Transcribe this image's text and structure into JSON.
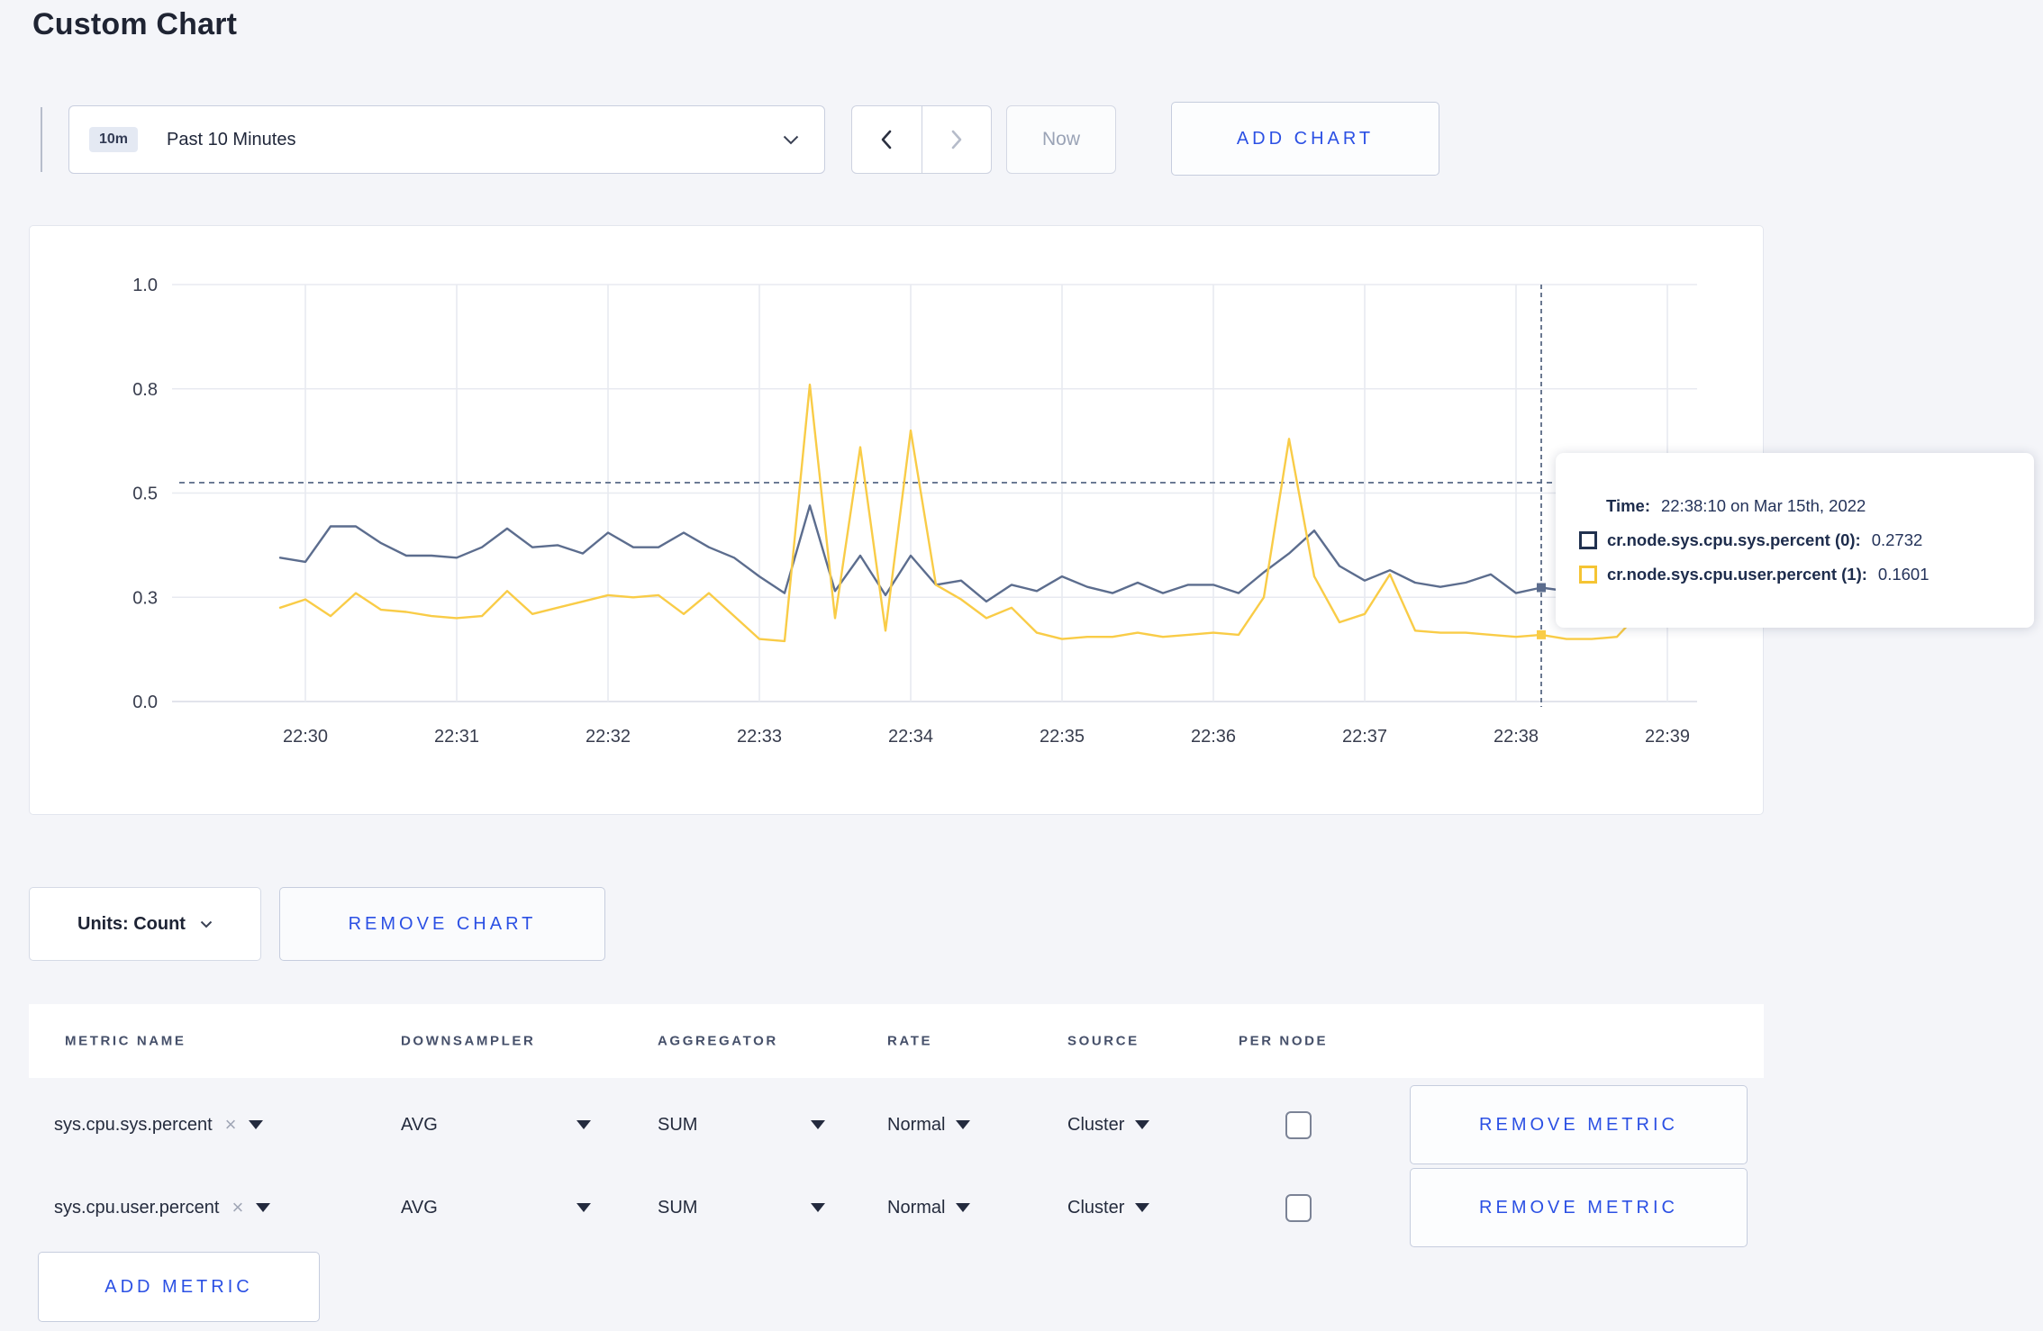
{
  "page": {
    "title": "Custom Chart"
  },
  "toolbar": {
    "range_badge": "10m",
    "range_label": "Past 10 Minutes",
    "now_label": "Now",
    "add_chart_label": "ADD CHART"
  },
  "units": {
    "label": "Units: Count",
    "remove_chart_label": "REMOVE CHART"
  },
  "chart_data": {
    "type": "line",
    "title": "",
    "xlabel": "",
    "ylabel": "",
    "ylim": [
      0,
      1
    ],
    "grid": true,
    "x_ticks": [
      "22:30",
      "22:31",
      "22:32",
      "22:33",
      "22:34",
      "22:35",
      "22:36",
      "22:37",
      "22:38",
      "22:39"
    ],
    "y_ticks": [
      {
        "v": 0.0,
        "label": "0.0"
      },
      {
        "v": 0.25,
        "label": "0.3"
      },
      {
        "v": 0.5,
        "label": "0.5"
      },
      {
        "v": 0.75,
        "label": "0.8"
      },
      {
        "v": 1.0,
        "label": "1.0"
      }
    ],
    "x_seconds_origin": "22:30:00",
    "dashed_guideline_value": 0.525,
    "crosshair": {
      "t": 490,
      "time": "22:38:10"
    },
    "series": [
      {
        "name": "cr.node.sys.cpu.sys.percent",
        "node": "(0)",
        "color": "#5c6d8e",
        "hover_value": 0.2732,
        "points": [
          [
            -10,
            0.345
          ],
          [
            0,
            0.335
          ],
          [
            10,
            0.42
          ],
          [
            20,
            0.42
          ],
          [
            30,
            0.38
          ],
          [
            40,
            0.35
          ],
          [
            50,
            0.35
          ],
          [
            60,
            0.345
          ],
          [
            70,
            0.37
          ],
          [
            80,
            0.415
          ],
          [
            90,
            0.37
          ],
          [
            100,
            0.375
          ],
          [
            110,
            0.355
          ],
          [
            120,
            0.405
          ],
          [
            130,
            0.37
          ],
          [
            140,
            0.37
          ],
          [
            150,
            0.405
          ],
          [
            160,
            0.37
          ],
          [
            170,
            0.345
          ],
          [
            180,
            0.3
          ],
          [
            190,
            0.26
          ],
          [
            200,
            0.47
          ],
          [
            210,
            0.265
          ],
          [
            220,
            0.35
          ],
          [
            230,
            0.255
          ],
          [
            240,
            0.35
          ],
          [
            250,
            0.28
          ],
          [
            260,
            0.29
          ],
          [
            270,
            0.24
          ],
          [
            280,
            0.28
          ],
          [
            290,
            0.265
          ],
          [
            300,
            0.3
          ],
          [
            310,
            0.275
          ],
          [
            320,
            0.26
          ],
          [
            330,
            0.285
          ],
          [
            340,
            0.26
          ],
          [
            350,
            0.28
          ],
          [
            360,
            0.28
          ],
          [
            370,
            0.26
          ],
          [
            380,
            0.31
          ],
          [
            390,
            0.355
          ],
          [
            400,
            0.41
          ],
          [
            410,
            0.325
          ],
          [
            420,
            0.29
          ],
          [
            430,
            0.315
          ],
          [
            440,
            0.285
          ],
          [
            450,
            0.275
          ],
          [
            460,
            0.285
          ],
          [
            470,
            0.305
          ],
          [
            480,
            0.26
          ],
          [
            490,
            0.2732
          ],
          [
            500,
            0.265
          ],
          [
            510,
            0.25
          ],
          [
            520,
            0.255
          ],
          [
            530,
            0.27
          ],
          [
            540,
            0.305
          ],
          [
            550,
            0.29
          ],
          [
            560,
            0.295
          ]
        ]
      },
      {
        "name": "cr.node.sys.cpu.user.percent",
        "node": "(1)",
        "color": "#f9cc47",
        "hover_value": 0.1601,
        "points": [
          [
            -10,
            0.225
          ],
          [
            0,
            0.245
          ],
          [
            10,
            0.205
          ],
          [
            20,
            0.26
          ],
          [
            30,
            0.22
          ],
          [
            40,
            0.215
          ],
          [
            50,
            0.205
          ],
          [
            60,
            0.2
          ],
          [
            70,
            0.205
          ],
          [
            80,
            0.265
          ],
          [
            90,
            0.21
          ],
          [
            100,
            0.225
          ],
          [
            110,
            0.24
          ],
          [
            120,
            0.255
          ],
          [
            130,
            0.25
          ],
          [
            140,
            0.255
          ],
          [
            150,
            0.21
          ],
          [
            160,
            0.26
          ],
          [
            170,
            0.205
          ],
          [
            180,
            0.15
          ],
          [
            190,
            0.145
          ],
          [
            200,
            0.76
          ],
          [
            210,
            0.2
          ],
          [
            220,
            0.61
          ],
          [
            230,
            0.17
          ],
          [
            240,
            0.65
          ],
          [
            250,
            0.28
          ],
          [
            260,
            0.245
          ],
          [
            270,
            0.2
          ],
          [
            280,
            0.225
          ],
          [
            290,
            0.165
          ],
          [
            300,
            0.15
          ],
          [
            310,
            0.155
          ],
          [
            320,
            0.155
          ],
          [
            330,
            0.165
          ],
          [
            340,
            0.155
          ],
          [
            350,
            0.16
          ],
          [
            360,
            0.165
          ],
          [
            370,
            0.16
          ],
          [
            380,
            0.25
          ],
          [
            390,
            0.63
          ],
          [
            400,
            0.3
          ],
          [
            410,
            0.19
          ],
          [
            420,
            0.21
          ],
          [
            430,
            0.305
          ],
          [
            440,
            0.17
          ],
          [
            450,
            0.165
          ],
          [
            460,
            0.165
          ],
          [
            470,
            0.16
          ],
          [
            480,
            0.155
          ],
          [
            490,
            0.1601
          ],
          [
            500,
            0.15
          ],
          [
            510,
            0.15
          ],
          [
            520,
            0.155
          ],
          [
            530,
            0.22
          ],
          [
            540,
            0.3
          ],
          [
            550,
            0.18
          ],
          [
            560,
            0.27
          ]
        ]
      }
    ],
    "tooltip": {
      "time_label": "Time:",
      "time_value": "22:38:10 on Mar 15th, 2022",
      "rows": [
        {
          "label": "cr.node.sys.cpu.sys.percent (0):",
          "value": "0.2732",
          "color": "#1c2c49"
        },
        {
          "label": "cr.node.sys.cpu.user.percent (1):",
          "value": "0.1601",
          "color": "#f5c433"
        }
      ]
    }
  },
  "table": {
    "headers": [
      "METRIC NAME",
      "DOWNSAMPLER",
      "AGGREGATOR",
      "RATE",
      "SOURCE",
      "PER NODE"
    ],
    "rows": [
      {
        "metric": "sys.cpu.sys.percent",
        "downsampler": "AVG",
        "aggregator": "SUM",
        "rate": "Normal",
        "source": "Cluster",
        "per_node_checked": false,
        "remove_label": "REMOVE METRIC"
      },
      {
        "metric": "sys.cpu.user.percent",
        "downsampler": "AVG",
        "aggregator": "SUM",
        "rate": "Normal",
        "source": "Cluster",
        "per_node_checked": false,
        "remove_label": "REMOVE METRIC"
      }
    ],
    "add_metric_label": "ADD METRIC"
  },
  "colors": {
    "accent_blue": "#2b50e4",
    "series_sys": "#5c6d8e",
    "series_user": "#f9cc47",
    "grid": "#e8eaf0",
    "page_bg": "#f4f5f9"
  }
}
